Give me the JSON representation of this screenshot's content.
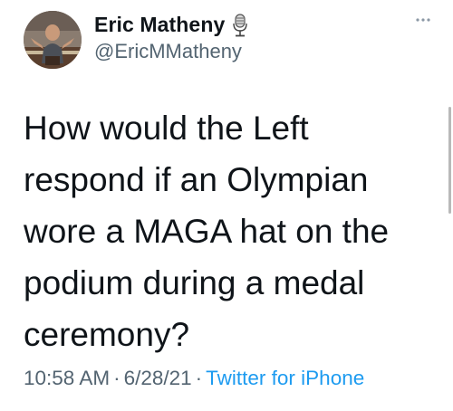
{
  "author": {
    "display_name": "Eric Matheny",
    "handle": "@EricMMatheny",
    "badge_icon": "microphone-icon"
  },
  "tweet": {
    "text": "How would the Left respond if an Olympian wore a MAGA hat on the podium during a medal ceremony?"
  },
  "meta": {
    "time": "10:58 AM",
    "separator": "·",
    "date": "6/28/21",
    "source": "Twitter for iPhone"
  },
  "colors": {
    "text": "#0f1419",
    "secondary": "#536471",
    "link": "#1d9bf0"
  }
}
